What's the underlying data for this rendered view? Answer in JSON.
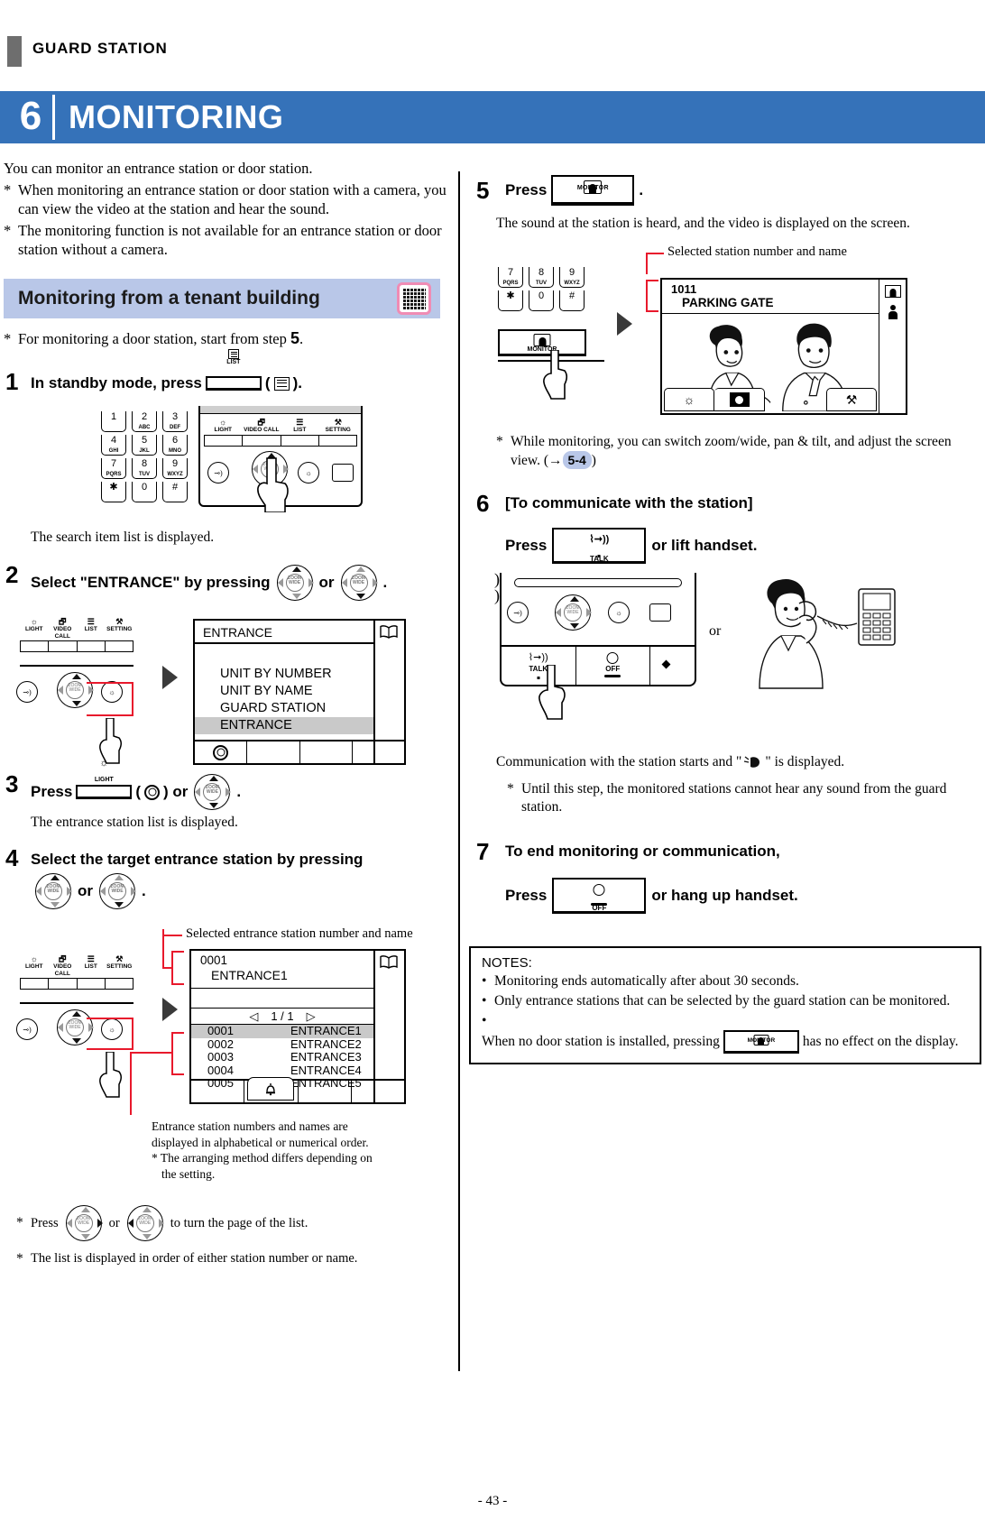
{
  "header": {
    "running_head": "GUARD STATION",
    "chapter_number": "6",
    "chapter_title": "MONITORING"
  },
  "intro": {
    "lead": "You can monitor an entrance station or door station.",
    "bullets": [
      "When monitoring an entrance station or door station with a camera, you can view the video at the station and hear the sound.",
      "The monitoring function is not available for an entrance station or door station without a camera."
    ]
  },
  "section": {
    "title": "Monitoring from a tenant building",
    "icon": "tenant-building-icon",
    "note_prefix": "For monitoring a door station, start from step",
    "note_step": "5",
    "note_suffix": "."
  },
  "steps": {
    "s1": {
      "num": "1",
      "head_a": "In standby mode, press",
      "key_label": "LIST",
      "head_b": "(",
      "head_c": ").",
      "sub": "The search item list is displayed."
    },
    "s2": {
      "num": "2",
      "head_a": "Select \"ENTRANCE\" by pressing",
      "head_or": "or",
      "head_end": ".",
      "screen": {
        "title": "ENTRANCE",
        "items": [
          {
            "label": "UNIT BY NUMBER",
            "selected": false
          },
          {
            "label": "UNIT BY NAME",
            "selected": false
          },
          {
            "label": "GUARD STATION",
            "selected": false
          },
          {
            "label": "ENTRANCE",
            "selected": true
          }
        ]
      }
    },
    "s3": {
      "num": "3",
      "head_a": "Press",
      "key_label": "LIGHT",
      "head_b": "(",
      "head_c": ") or",
      "head_d": ".",
      "sub": "The entrance station list is displayed."
    },
    "s4": {
      "num": "4",
      "head_a": "Select the target entrance station by pressing",
      "head_or": "or",
      "head_end": ".",
      "callout_top": "Selected entrance station number and name",
      "screen": {
        "sel_number": "0001",
        "sel_name": "ENTRANCE1",
        "page_indicator": "1 / 1",
        "prev_arrow": "◁",
        "next_arrow": "▷",
        "columns": [
          "number",
          "name"
        ],
        "rows": [
          {
            "number": "0001",
            "name": "ENTRANCE1",
            "selected": true
          },
          {
            "number": "0002",
            "name": "ENTRANCE2",
            "selected": false
          },
          {
            "number": "0003",
            "name": "ENTRANCE3",
            "selected": false
          },
          {
            "number": "0004",
            "name": "ENTRANCE4",
            "selected": false
          },
          {
            "number": "0005",
            "name": "ENTRANCE5",
            "selected": false
          }
        ]
      },
      "callout_bottom_l1": "Entrance station numbers and names are",
      "callout_bottom_l2": "displayed in alphabetical or numerical order.",
      "callout_bottom_l3": "* The arranging method differs depending on",
      "callout_bottom_l4": "the setting.",
      "footnotes": [
        {
          "pre": "Press",
          "mid": "or",
          "post": "to turn the page of the list."
        },
        {
          "text": "The list is displayed in order of either station number or name."
        }
      ]
    },
    "s5": {
      "num": "5",
      "head_a": "Press",
      "key_label": "MONITOR",
      "head_b": ".",
      "sub": "The sound at the station is heard, and the video is displayed on the screen.",
      "callout_top": "Selected station number and name",
      "keypad": {
        "keys": [
          {
            "n": "7",
            "a": "PQRS"
          },
          {
            "n": "8",
            "a": "TUV"
          },
          {
            "n": "9",
            "a": "WXYZ"
          },
          {
            "n": "✱",
            "a": ""
          },
          {
            "n": "0",
            "a": ""
          },
          {
            "n": "#",
            "a": ""
          }
        ],
        "monitor_label": "MONITOR"
      },
      "screen": {
        "station_number": "1011",
        "station_name": "PARKING GATE",
        "toolbar": [
          "brightness-icon",
          "camera-icon",
          "tools-icon"
        ]
      },
      "note": "While monitoring, you can switch zoom/wide, pan & tilt, and adjust the screen view. (→",
      "note_ref": "5-4",
      "note_tail": ")"
    },
    "s6": {
      "num": "6",
      "head": "[To communicate with the station]",
      "press_a": "Press",
      "key_label": "TALK",
      "press_b": "or lift handset.",
      "or_label": "or",
      "off_label": "OFF",
      "result_a": "Communication with the station starts and \"",
      "result_b": "\" is displayed.",
      "note": "Until this step, the monitored stations cannot hear any sound from the guard station."
    },
    "s7": {
      "num": "7",
      "head": "To end monitoring or communication,",
      "press_a": "Press",
      "key_label": "OFF",
      "press_b": "or hang up handset."
    }
  },
  "notes": {
    "title": "NOTES:",
    "items": [
      {
        "text": "Monitoring ends automatically after about 30 seconds."
      },
      {
        "text": "Only entrance stations that can be selected by the guard station can be monitored."
      },
      {
        "pre": "When no door station is installed, pressing",
        "key_label": "MONITOR",
        "post": "has no effect on the display."
      }
    ]
  },
  "footer": {
    "page": "- 43 -"
  },
  "softkeys": {
    "labels": [
      "LIGHT",
      "VIDEO CALL",
      "LIST",
      "SETTING"
    ]
  },
  "colors": {
    "banner_blue": "#3572b9",
    "band_blue": "#b9c7e8",
    "leader_red": "#e8192c",
    "selected_gray": "#c9c9c9"
  }
}
